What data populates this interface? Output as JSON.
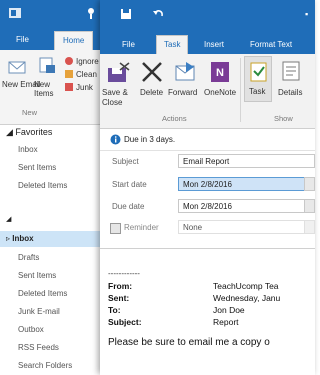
{
  "back": {
    "tabs": [
      "File",
      "Home"
    ],
    "ribbon": {
      "new_email": "New Email",
      "new_items": "New Items",
      "ignore": "Ignore",
      "clean_up": "Clean",
      "junk": "Junk",
      "group_label": "New"
    },
    "favorites_header": "Favorites",
    "favorites": [
      "Inbox",
      "Sent Items",
      "Deleted Items"
    ],
    "folders_selected": "Inbox",
    "folders": [
      "Drafts",
      "Sent Items",
      "Deleted Items",
      "Junk E-mail",
      "Outbox",
      "RSS Feeds",
      "Search Folders"
    ]
  },
  "task": {
    "tabs": [
      "File",
      "Task",
      "Insert",
      "Format Text"
    ],
    "ribbon": {
      "save_close": "Save & Close",
      "delete": "Delete",
      "forward": "Forward",
      "onenote": "OneNote",
      "task": "Task",
      "details": "Details",
      "group_actions": "Actions",
      "group_show": "Show"
    },
    "due_notice": "Due in 3 days.",
    "subject_label": "Subject",
    "subject_value": "Email Report",
    "start_label": "Start date",
    "start_value": "Mon 2/8/2016",
    "due_label": "Due date",
    "due_value": "Mon 2/8/2016",
    "reminder_label": "Reminder",
    "reminder_value": "None",
    "body": {
      "separator": "------------",
      "from_label": "From:",
      "from_value": "TeachUcomp Tea",
      "sent_label": "Sent:",
      "sent_value": "Wednesday, Janu",
      "to_label": "To:",
      "to_value": "Jon Doe",
      "subject_label": "Subject:",
      "subject_value": "Report",
      "message": "Please be sure to email me a copy o"
    }
  },
  "colors": {
    "title_blue": "#1f6db8",
    "ribbon_bg": "#f2f2f2",
    "selected_field": "#cfe3f7"
  }
}
